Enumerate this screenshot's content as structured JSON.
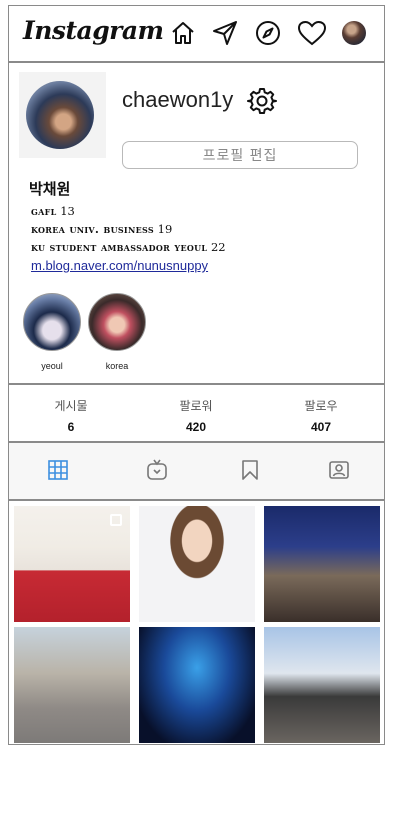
{
  "header": {
    "logo": "Instagram",
    "icons": [
      "home-icon",
      "send-icon",
      "compass-icon",
      "heart-icon",
      "avatar"
    ]
  },
  "profile": {
    "username": "chaewon1y",
    "edit_button": "프로필 편집",
    "real_name": "박채원",
    "bio": [
      {
        "label": "gafl",
        "value": "13"
      },
      {
        "label": "korea univ. business",
        "value": "19"
      },
      {
        "label": "ku student ambassador yeoul",
        "value": "22"
      }
    ],
    "link": "m.blog.naver.com/nunusnuppy"
  },
  "highlights": [
    {
      "label": "yeoul"
    },
    {
      "label": "korea"
    }
  ],
  "stats": [
    {
      "label": "게시물",
      "value": "6"
    },
    {
      "label": "팔로워",
      "value": "420"
    },
    {
      "label": "팔로우",
      "value": "407"
    }
  ],
  "tabs": [
    "grid-icon",
    "igtv-icon",
    "bookmark-icon",
    "tagged-icon"
  ],
  "colors": {
    "accent": "#3d8fe0",
    "link": "#1f2a9a",
    "border": "#8a8a8a"
  }
}
